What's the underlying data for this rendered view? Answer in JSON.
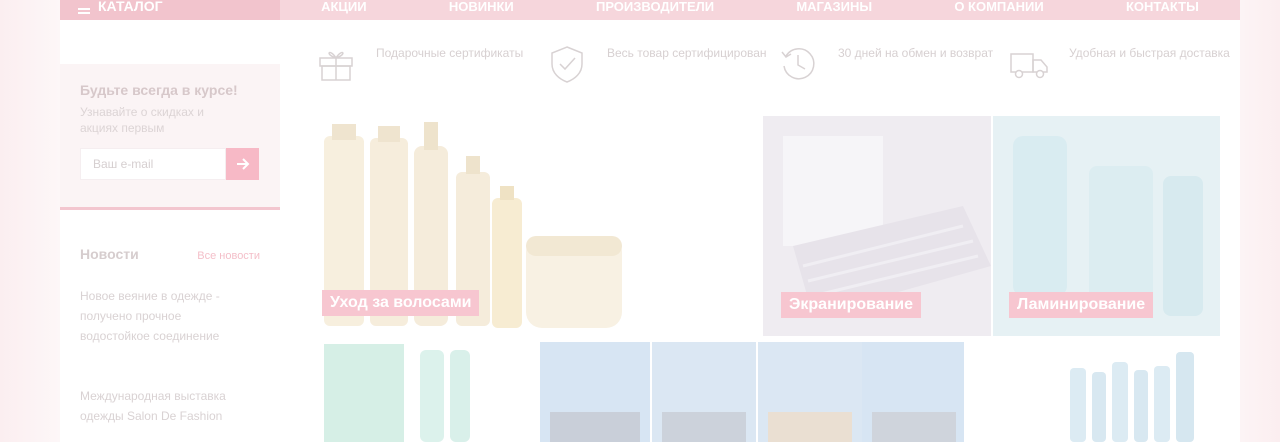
{
  "nav": {
    "catalog_label": "КАТАЛОГ",
    "items": [
      "АКЦИИ",
      "НОВИНКИ",
      "ПРОИЗВОДИТЕЛИ",
      "МАГАЗИНЫ",
      "О КОМПАНИИ",
      "КОНТАКТЫ"
    ]
  },
  "subscribe": {
    "title": "Будьте всегда в курсе!",
    "subtitle": "Узнавайте о скидках и акциях первым",
    "placeholder": "Ваш e-mail",
    "submit_icon": "arrow-right-icon"
  },
  "news": {
    "heading": "Новости",
    "all_link": "Все новости",
    "items": [
      "Новое веяние в одежде - получено прочное водостойкое соединение",
      "Международная выставка одежды Salon De Fashion"
    ]
  },
  "features": [
    {
      "icon": "gift-icon",
      "text": "Подарочные сертификаты"
    },
    {
      "icon": "shield-check-icon",
      "text": "Весь товар сертифицирован"
    },
    {
      "icon": "history-icon",
      "text": "30 дней на обмен и возврат"
    },
    {
      "icon": "truck-icon",
      "text": "Удобная и быстрая доставка"
    }
  ],
  "banners": [
    {
      "label": "Уход за волосами"
    },
    {
      "label": "Экранирование"
    },
    {
      "label": "Ламинирование"
    }
  ],
  "colors": {
    "accent": "#f7b9c6",
    "nav_bg": "#f6d6dc"
  }
}
